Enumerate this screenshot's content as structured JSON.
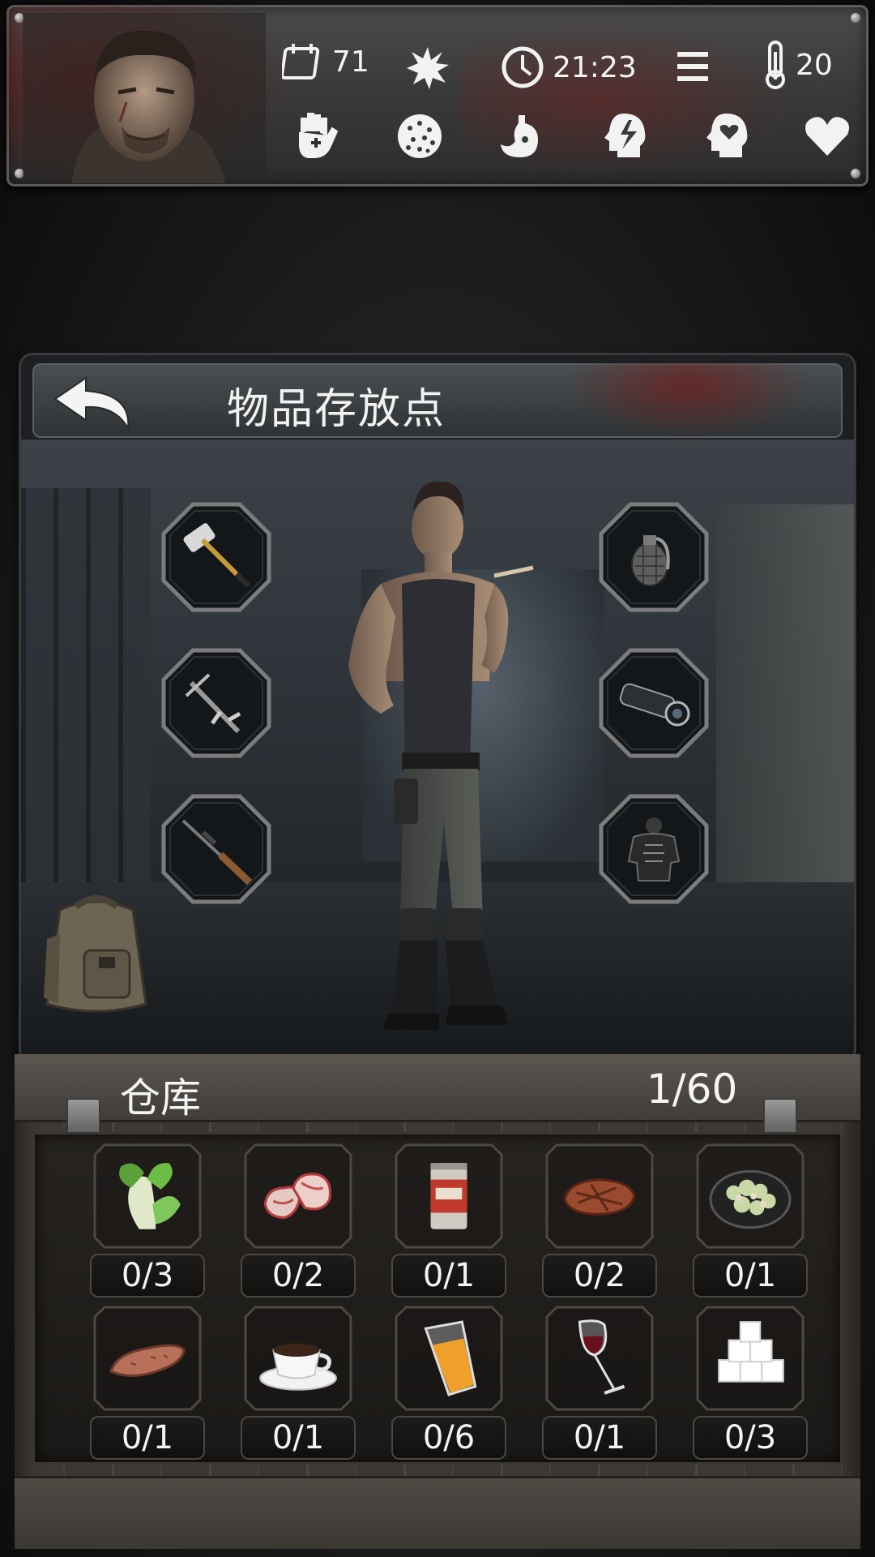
{
  "status_bar": {
    "day": "71",
    "time": "21:23",
    "temperature": "20",
    "icons": {
      "calendar": "calendar-icon",
      "weather": "sun-icon",
      "clock": "clock-icon",
      "menu": "menu-icon",
      "thermometer": "thermometer-icon"
    },
    "condition_icons": [
      "health-hand-icon",
      "virus-icon",
      "stomach-icon",
      "energy-head-icon",
      "mood-head-icon",
      "heart-icon"
    ]
  },
  "panel": {
    "title": "物品存放点",
    "equipment_slots": {
      "left": [
        "sledgehammer",
        "crossbow",
        "rifle"
      ],
      "right": [
        "grenade",
        "rifle-scope",
        "body-armor"
      ]
    }
  },
  "warehouse": {
    "title": "仓库",
    "capacity": "1/60",
    "items": [
      {
        "name": "bok-choy",
        "qty": "0/3"
      },
      {
        "name": "raw-meat",
        "qty": "0/2"
      },
      {
        "name": "canned-food",
        "qty": "0/1"
      },
      {
        "name": "steak",
        "qty": "0/2"
      },
      {
        "name": "salad-plate",
        "qty": "0/1"
      },
      {
        "name": "sweet-potato",
        "qty": "0/1"
      },
      {
        "name": "coffee-cup",
        "qty": "0/1"
      },
      {
        "name": "juice-glass",
        "qty": "0/6"
      },
      {
        "name": "wine-glass",
        "qty": "0/1"
      },
      {
        "name": "sugar-cubes",
        "qty": "0/3"
      }
    ]
  }
}
